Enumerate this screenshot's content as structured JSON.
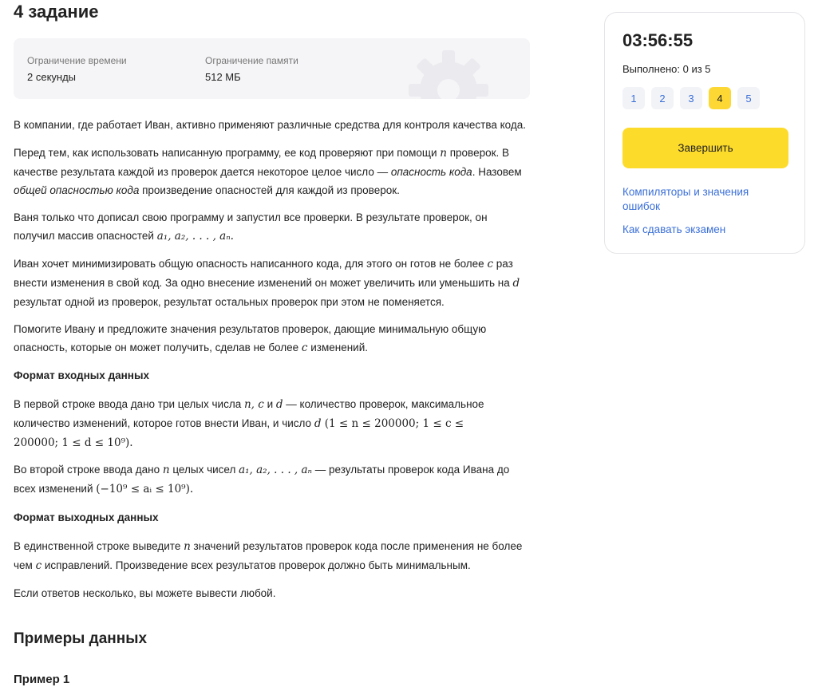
{
  "task": {
    "title": "4 задание",
    "limits": [
      {
        "label": "Ограничение времени",
        "value": "2 секунды"
      },
      {
        "label": "Ограничение памяти",
        "value": "512 МБ"
      }
    ]
  },
  "statement": {
    "p1": "В компании, где работает Иван, активно применяют различные средства для контроля качества кода.",
    "p2": {
      "a": "Перед тем, как использовать написанную программу, ее код проверяют при помощи ",
      "var_n": "n",
      "b": " проверок. В качестве результата каждой из проверок дается некоторое целое число — ",
      "em1": "опасность кода",
      "c": ". Назовем ",
      "em2": "общей опасностью кода",
      "d": " произведение опасностей для каждой из проверок."
    },
    "p3": {
      "a": "Ваня только что дописал свою программу и запустил все проверки. В результате проверок, он получил массив опасностей ",
      "math": "a₁, a₂, . . . , aₙ."
    },
    "p4": {
      "a": "Иван хочет минимизировать общую опасность написанного кода, для этого он готов не более ",
      "var_c": "c",
      "b": " раз внести изменения в свой код. За одно внесение изменений он может увеличить или уменьшить на ",
      "var_d": "d",
      "c": " результат одной из проверок, результат остальных проверок при этом не поменяется."
    },
    "p5": {
      "a": "Помогите Ивану и предложите значения результатов проверок, дающие минимальную общую опасность, которые он может получить, сделав не более ",
      "var_c": "c",
      "b": " изменений."
    },
    "input_heading": "Формат входных данных",
    "p6": {
      "a": "В первой строке ввода дано три целых числа ",
      "vars": "n, c",
      "and": " и ",
      "var_d": "d",
      "b": " — количество проверок, максимальное количество изменений, которое готов внести Иван, и число ",
      "var_d2": "d",
      "math": " (1 ≤ n ≤ 200000; 1 ≤ c ≤ 200000; 1 ≤ d ≤ 10⁹)."
    },
    "p7": {
      "a": "Во второй строке ввода дано ",
      "var_n": "n",
      "b": " целых чисел ",
      "math1": "a₁, a₂, . . . , aₙ",
      "c": " — результаты проверок кода Ивана до всех изменений ",
      "math2": "(−10⁹ ≤ aᵢ ≤ 10⁹)."
    },
    "output_heading": "Формат выходных данных",
    "p8": {
      "a": "В единственной строке выведите ",
      "var_n": "n",
      "b": " значений результатов проверок кода после применения не более чем ",
      "var_c": "c",
      "c": " исправлений. Произведение всех результатов проверок должно быть минимальным."
    },
    "p9": "Если ответов несколько, вы можете вывести любой."
  },
  "examples": {
    "title": "Примеры данных",
    "example1_title": "Пример 1"
  },
  "panel": {
    "timer": "03:56:55",
    "progress": "Выполнено: 0 из 5",
    "questions": [
      "1",
      "2",
      "3",
      "4",
      "5"
    ],
    "active_question": "4",
    "finish_label": "Завершить",
    "links": {
      "compilers": "Компиляторы и значения ошибок",
      "how_to": "Как сдавать экзамен"
    }
  },
  "colors": {
    "accent_yellow": "#fddb2b",
    "link_blue": "#3a6fd8",
    "limits_bg": "#f5f5f7"
  }
}
